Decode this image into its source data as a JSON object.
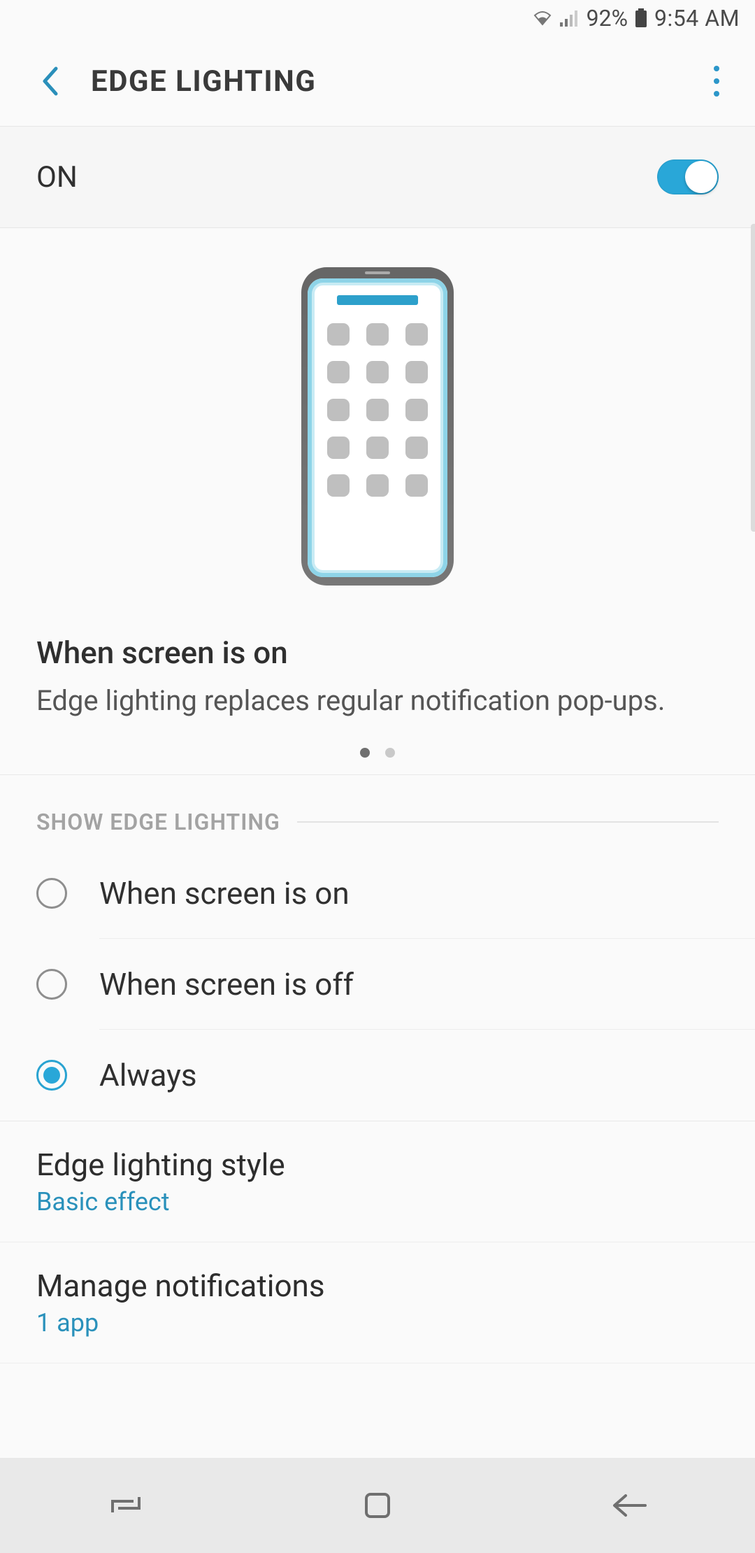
{
  "statusbar": {
    "battery_pct": "92%",
    "time": "9:54 AM"
  },
  "appbar": {
    "title": "EDGE LIGHTING"
  },
  "master_toggle": {
    "label": "ON",
    "enabled": true
  },
  "preview": {
    "title": "When screen is on",
    "description": "Edge lighting replaces regular notification pop-ups.",
    "active_page": 0,
    "page_count": 2
  },
  "section_show": {
    "header": "SHOW EDGE LIGHTING"
  },
  "radio_options": [
    {
      "label": "When screen is on",
      "selected": false
    },
    {
      "label": "When screen is off",
      "selected": false
    },
    {
      "label": "Always",
      "selected": true
    }
  ],
  "settings": [
    {
      "title": "Edge lighting style",
      "subtitle": "Basic effect"
    },
    {
      "title": "Manage notifications",
      "subtitle": "1 app"
    }
  ]
}
